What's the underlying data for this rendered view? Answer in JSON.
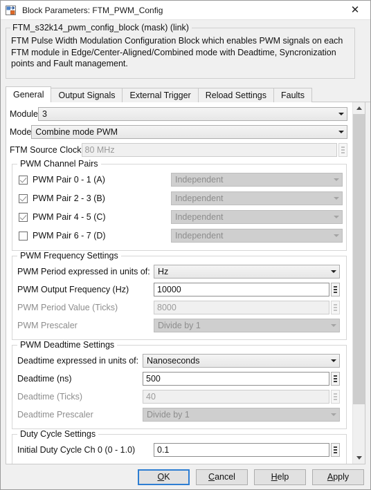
{
  "window": {
    "title": "Block Parameters: FTM_PWM_Config",
    "icon": "simulink-block-icon",
    "close_label": "✕"
  },
  "description": {
    "legend": "FTM_s32k14_pwm_config_block (mask) (link)",
    "body": "FTM Pulse Width Modulation Configuration Block which enables PWM signals on each FTM module in Edge/Center-Aligned/Combined mode with Deadtime, Syncronization points and Fault management."
  },
  "tabs": [
    {
      "label": "General",
      "active": true
    },
    {
      "label": "Output Signals",
      "active": false
    },
    {
      "label": "External Trigger",
      "active": false
    },
    {
      "label": "Reload Settings",
      "active": false
    },
    {
      "label": "Faults",
      "active": false
    }
  ],
  "general": {
    "module": {
      "label": "Module",
      "value": "3",
      "type": "combo",
      "enabled": true
    },
    "mode": {
      "label": "Mode",
      "value": "Combine mode PWM",
      "type": "combo",
      "enabled": true
    },
    "source_clock": {
      "label": "FTM Source Clock",
      "value": "80 MHz",
      "type": "text-spinner",
      "enabled": false
    },
    "channel_pairs": {
      "legend": "PWM Channel Pairs",
      "rows": [
        {
          "label": "PWM Pair 0 - 1 (A)",
          "checked": true,
          "mode": "Independent",
          "mode_enabled": false
        },
        {
          "label": "PWM Pair 2 - 3 (B)",
          "checked": true,
          "mode": "Independent",
          "mode_enabled": false
        },
        {
          "label": "PWM Pair 4 - 5 (C)",
          "checked": true,
          "mode": "Independent",
          "mode_enabled": false
        },
        {
          "label": "PWM Pair 6 - 7 (D)",
          "checked": false,
          "mode": "Independent",
          "mode_enabled": false
        }
      ]
    },
    "frequency": {
      "legend": "PWM Frequency Settings",
      "units": {
        "label": "PWM Period expressed in units of:",
        "value": "Hz",
        "enabled": true
      },
      "output_frequency": {
        "label": "PWM Output Frequency (Hz)",
        "value": "10000",
        "enabled": true
      },
      "period_ticks": {
        "label": "PWM Period Value (Ticks)",
        "value": "8000",
        "enabled": false
      },
      "prescaler": {
        "label": "PWM Prescaler",
        "value": "Divide by 1",
        "enabled": false
      }
    },
    "deadtime": {
      "legend": "PWM Deadtime Settings",
      "units": {
        "label": "Deadtime expressed in units of:",
        "value": "Nanoseconds",
        "enabled": true
      },
      "deadtime_ns": {
        "label": "Deadtime (ns)",
        "value": "500",
        "enabled": true
      },
      "deadtime_ticks": {
        "label": "Deadtime (Ticks)",
        "value": "40",
        "enabled": false
      },
      "prescaler": {
        "label": "Deadtime Prescaler",
        "value": "Divide by 1",
        "enabled": false
      }
    },
    "duty_cycle": {
      "legend": "Duty Cycle Settings",
      "ch0": {
        "label": "Initial Duty Cycle Ch 0 (0 - 1.0)",
        "value": "0.1",
        "enabled": true
      }
    }
  },
  "footer": {
    "ok": "OK",
    "cancel": "Cancel",
    "help": "Help",
    "apply": "Apply"
  },
  "colors": {
    "accent": "#2d7dd2",
    "pane_bg": "#ffffff",
    "dialog_bg": "#f0f0f0",
    "disabled_text": "#8d8d8d"
  }
}
